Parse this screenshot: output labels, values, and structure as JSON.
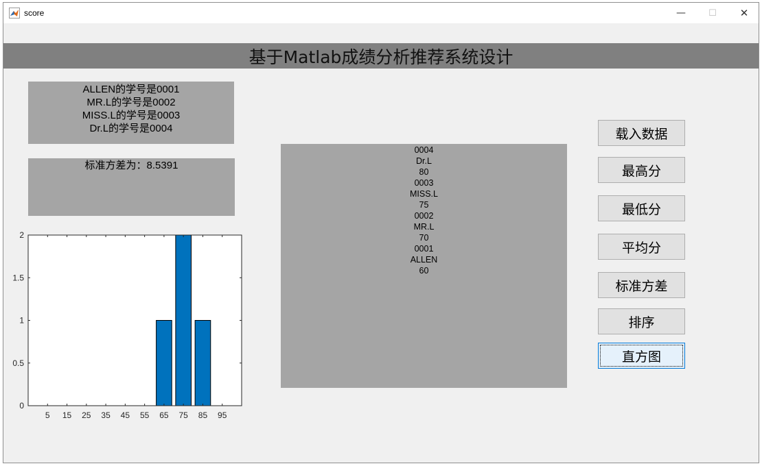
{
  "window": {
    "title": "score",
    "minimize": "—",
    "maximize": "☐",
    "close": "✕"
  },
  "header": {
    "title": "基于Matlab成绩分析推荐系统设计"
  },
  "id_panel": {
    "lines": [
      "ALLEN的学号是0001",
      "MR.L的学号是0002",
      "MISS.L的学号是0003",
      "Dr.L的学号是0004"
    ]
  },
  "std_panel": {
    "text": "标准方差为：8.5391"
  },
  "list_panel": {
    "items": [
      "0004",
      "Dr.L",
      "80",
      "0003",
      "MISS.L",
      "75",
      "0002",
      "MR.L",
      "70",
      "0001",
      "ALLEN",
      "60"
    ]
  },
  "buttons": {
    "load": "载入数据",
    "max": "最高分",
    "min": "最低分",
    "avg": "平均分",
    "std": "标准方差",
    "sort": "排序",
    "hist": "直方图"
  },
  "chart_data": {
    "type": "bar",
    "categories": [
      "5",
      "15",
      "25",
      "35",
      "45",
      "55",
      "65",
      "75",
      "85",
      "95"
    ],
    "values": [
      0,
      0,
      0,
      0,
      0,
      0,
      1,
      2,
      1,
      0
    ],
    "xlim": [
      -5,
      105
    ],
    "ylim": [
      0,
      2
    ],
    "yticks": [
      "0",
      "0.5",
      "1",
      "1.5",
      "2"
    ],
    "bar_color": "#0072BD",
    "title": "",
    "xlabel": "",
    "ylabel": ""
  }
}
